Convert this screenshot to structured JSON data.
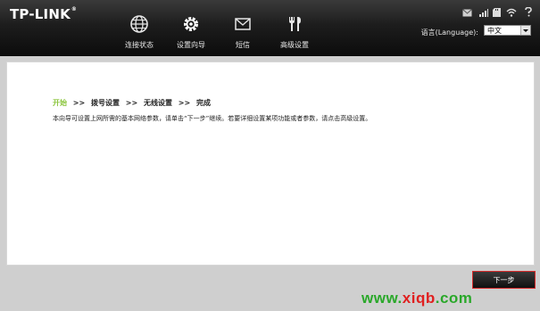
{
  "brand": {
    "logo": "TP-LINK",
    "reg": "®"
  },
  "nav": [
    {
      "label": "连接状态",
      "icon": "globe-icon"
    },
    {
      "label": "设置向导",
      "icon": "gear-icon"
    },
    {
      "label": "短信",
      "icon": "envelope-icon"
    },
    {
      "label": "高级设置",
      "icon": "tools-icon"
    }
  ],
  "status_icons": [
    "mail-icon",
    "signal-icon",
    "sd-card-icon",
    "wifi-icon",
    "help-icon"
  ],
  "language": {
    "label": "语言(Language):",
    "value": "中文"
  },
  "wizard": {
    "steps": [
      "开始",
      "拨号设置",
      "无线设置",
      "完成"
    ],
    "separator": ">>",
    "description": "本向导可设置上网所需的基本网络参数，请单击“下一步”继续。若要详细设置某项功能或者参数，请点击高级设置。"
  },
  "next_button": "下一步",
  "watermark": {
    "text": "www.xiqb.com"
  },
  "colors": {
    "header_bg": "#111111",
    "active_step": "#8cc63f",
    "watermark_green": "#2aa82a",
    "watermark_red": "#e02020"
  }
}
